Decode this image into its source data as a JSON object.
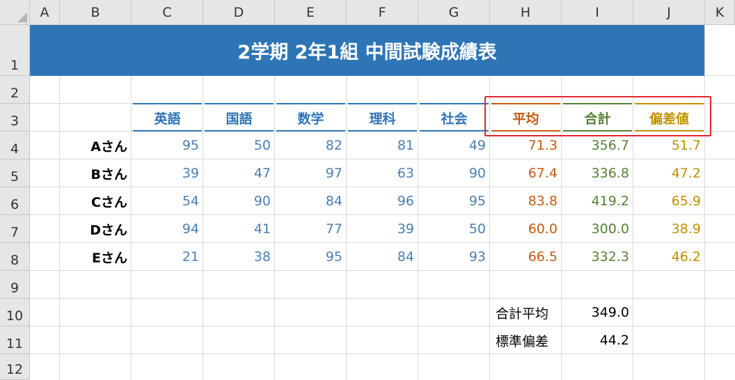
{
  "columns": [
    "A",
    "B",
    "C",
    "D",
    "E",
    "F",
    "G",
    "H",
    "I",
    "J",
    "K"
  ],
  "rows": [
    "1",
    "2",
    "3",
    "4",
    "5",
    "6",
    "7",
    "8",
    "9",
    "10",
    "11",
    "12"
  ],
  "title": "2学期 2年1組 中間試験成績表",
  "subjects": [
    "英語",
    "国語",
    "数学",
    "理科",
    "社会"
  ],
  "calc_headers": [
    "平均",
    "合計",
    "偏差値"
  ],
  "students": [
    {
      "name": "Aさん",
      "scores": [
        "95",
        "50",
        "82",
        "81",
        "49"
      ],
      "avg": "71.3",
      "total": "356.7",
      "dev": "51.7"
    },
    {
      "name": "Bさん",
      "scores": [
        "39",
        "47",
        "97",
        "63",
        "90"
      ],
      "avg": "67.4",
      "total": "336.8",
      "dev": "47.2"
    },
    {
      "name": "Cさん",
      "scores": [
        "54",
        "90",
        "84",
        "96",
        "95"
      ],
      "avg": "83.8",
      "total": "419.2",
      "dev": "65.9"
    },
    {
      "name": "Dさん",
      "scores": [
        "94",
        "41",
        "77",
        "39",
        "50"
      ],
      "avg": "60.0",
      "total": "300.0",
      "dev": "38.9"
    },
    {
      "name": "Eさん",
      "scores": [
        "21",
        "38",
        "95",
        "84",
        "93"
      ],
      "avg": "66.5",
      "total": "332.3",
      "dev": "46.2"
    }
  ],
  "summary": [
    {
      "label": "合計平均",
      "value": "349.0"
    },
    {
      "label": "標準偏差",
      "value": "44.2"
    }
  ],
  "colors": {
    "title_bg": "#2e75b6",
    "subject": "#2e75b6",
    "score": "#4a7fb5",
    "avg": "#c55a11",
    "total": "#548235",
    "dev": "#bf9000",
    "highlight": "#e0262f"
  },
  "icons": {
    "select_all": "select-all-triangle-icon"
  }
}
